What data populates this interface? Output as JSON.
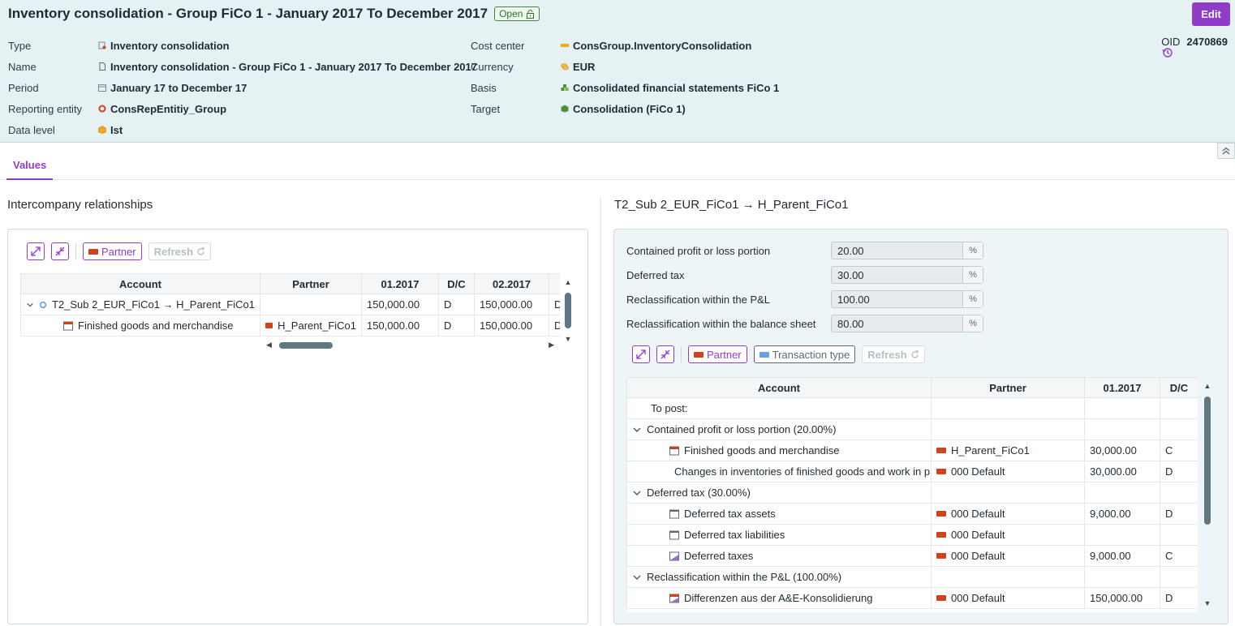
{
  "header": {
    "title": "Inventory consolidation - Group FiCo 1 - January 2017 To December 2017",
    "status": "Open",
    "edit_label": "Edit",
    "left": [
      {
        "label": "Type",
        "value": "Inventory consolidation"
      },
      {
        "label": "Name",
        "value": "Inventory consolidation - Group FiCo 1 - January 2017 To December 2017"
      },
      {
        "label": "Period",
        "value": "January 17 to December 17"
      },
      {
        "label": "Reporting entity",
        "value": "ConsRepEntitiy_Group"
      },
      {
        "label": "Data level",
        "value": "Ist"
      }
    ],
    "right": [
      {
        "label": "Cost center",
        "value": "ConsGroup.InventoryConsolidation"
      },
      {
        "label": "Currency",
        "value": "EUR"
      },
      {
        "label": "Basis",
        "value": "Consolidated financial statements FiCo 1"
      },
      {
        "label": "Target",
        "value": "Consolidation (FiCo 1)"
      }
    ],
    "oid_label": "OID",
    "oid_value": "2470869",
    "colors": {
      "accent": "#8f3cc9",
      "header_bg": "#e6f1f4",
      "flag": "#d0431a"
    }
  },
  "tabs": [
    {
      "label": "Values"
    }
  ],
  "left_panel": {
    "title": "Intercompany relationships",
    "toolbar": {
      "partner_label": "Partner",
      "refresh_label": "Refresh"
    },
    "columns": [
      "Account",
      "Partner",
      "01.2017",
      "D/C",
      "02.2017",
      "D"
    ],
    "rows": [
      {
        "account": "T2_Sub 2_EUR_FiCo1 → H_Parent_FiCo1",
        "partner": "",
        "v1": "150,000.00",
        "dc1": "D",
        "v2": "150,000.00",
        "dc2": "D"
      },
      {
        "account": "Finished goods and merchandise",
        "partner": "H_Parent_FiCo1",
        "v1": "150,000.00",
        "dc1": "D",
        "v2": "150,000.00",
        "dc2": "D"
      }
    ]
  },
  "right_panel": {
    "title": "T2_Sub 2_EUR_FiCo1 → H_Parent_FiCo1",
    "params": [
      {
        "label": "Contained profit or loss portion",
        "value": "20.00",
        "unit": "%"
      },
      {
        "label": "Deferred tax",
        "value": "30.00",
        "unit": "%"
      },
      {
        "label": "Reclassification within the P&L",
        "value": "100.00",
        "unit": "%"
      },
      {
        "label": "Reclassification within the balance sheet",
        "value": "80.00",
        "unit": "%"
      }
    ],
    "toolbar": {
      "partner_label": "Partner",
      "transaction_label": "Transaction type",
      "refresh_label": "Refresh"
    },
    "columns": [
      "Account",
      "Partner",
      "01.2017",
      "D/C"
    ],
    "rows": [
      {
        "level": 0,
        "account": "To post:",
        "partner": "",
        "value": "",
        "dc": ""
      },
      {
        "level": 0,
        "group": true,
        "account": "Contained profit or loss portion (20.00%)",
        "partner": "",
        "value": "",
        "dc": ""
      },
      {
        "level": 1,
        "icon": "balance",
        "account": "Finished goods and merchandise",
        "partner": "H_Parent_FiCo1",
        "value": "30,000.00",
        "dc": "C"
      },
      {
        "level": 1,
        "icon": "pl",
        "account": "Changes in inventories of finished goods and work in progress",
        "partner": "000 Default",
        "value": "30,000.00",
        "dc": "D"
      },
      {
        "level": 0,
        "group": true,
        "account": "Deferred tax (30.00%)",
        "partner": "",
        "value": "",
        "dc": ""
      },
      {
        "level": 1,
        "icon": "plain",
        "account": "Deferred tax assets",
        "partner": "000 Default",
        "value": "9,000.00",
        "dc": "D"
      },
      {
        "level": 1,
        "icon": "plain",
        "account": "Deferred tax liabilities",
        "partner": "000 Default",
        "value": "",
        "dc": ""
      },
      {
        "level": 1,
        "icon": "pl",
        "account": "Deferred taxes",
        "partner": "000 Default",
        "value": "9,000.00",
        "dc": "C"
      },
      {
        "level": 0,
        "group": true,
        "account": "Reclassification within the P&L (100.00%)",
        "partner": "",
        "value": "",
        "dc": ""
      },
      {
        "level": 1,
        "icon": "pl-red",
        "account": "Differenzen aus der A&E-Konsolidierung",
        "partner": "000 Default",
        "value": "150,000.00",
        "dc": "D"
      }
    ]
  }
}
